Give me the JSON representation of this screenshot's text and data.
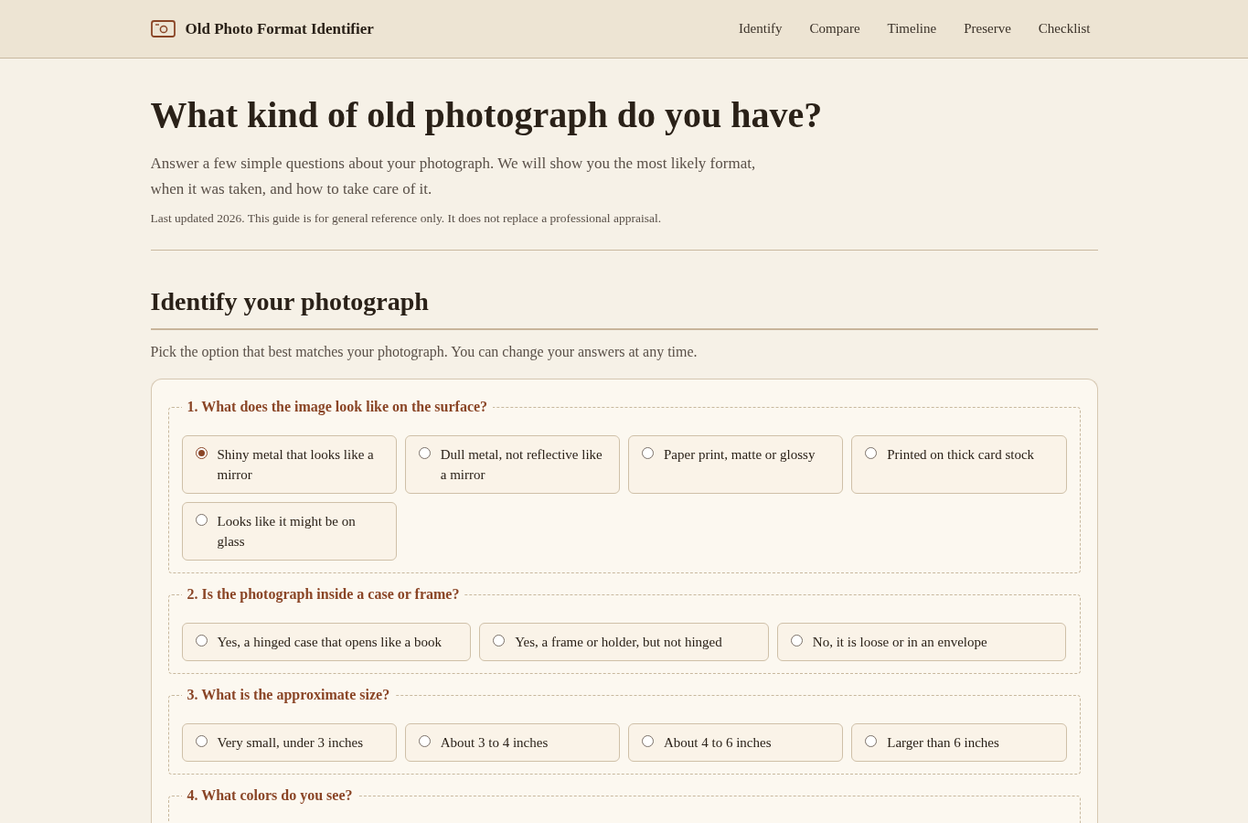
{
  "header": {
    "title": "Old Photo Format Identifier",
    "nav": [
      {
        "label": "Identify"
      },
      {
        "label": "Compare"
      },
      {
        "label": "Timeline"
      },
      {
        "label": "Preserve"
      },
      {
        "label": "Checklist"
      }
    ]
  },
  "intro": {
    "heading": "What kind of old photograph do you have?",
    "lead": "Answer a few simple questions about your photograph. We will show you the most likely format, when it was taken, and how to take care of it.",
    "note": "Last updated 2026. This guide is for general reference only. It does not replace a professional appraisal."
  },
  "section": {
    "heading": "Identify your photograph",
    "instructions": "Pick the option that best matches your photograph. You can change your answers at any time.",
    "questions": [
      {
        "legend": "1. What does the image look like on the surface?",
        "options": [
          {
            "label": "Shiny metal that looks like a mirror",
            "selected": true
          },
          {
            "label": "Dull metal, not reflective like a mirror",
            "selected": false
          },
          {
            "label": "Paper print, matte or glossy",
            "selected": false
          },
          {
            "label": "Printed on thick card stock",
            "selected": false
          },
          {
            "label": "Looks like it might be on glass",
            "selected": false
          }
        ]
      },
      {
        "legend": "2. Is the photograph inside a case or frame?",
        "options": [
          {
            "label": "Yes, a hinged case that opens like a book",
            "selected": false
          },
          {
            "label": "Yes, a frame or holder, but not hinged",
            "selected": false
          },
          {
            "label": "No, it is loose or in an envelope",
            "selected": false
          }
        ]
      },
      {
        "legend": "3. What is the approximate size?",
        "options": [
          {
            "label": "Very small, under 3 inches",
            "selected": false
          },
          {
            "label": "About 3 to 4 inches",
            "selected": false
          },
          {
            "label": "About 4 to 6 inches",
            "selected": false
          },
          {
            "label": "Larger than 6 inches",
            "selected": false
          }
        ]
      },
      {
        "legend": "4. What colors do you see?"
      }
    ]
  }
}
